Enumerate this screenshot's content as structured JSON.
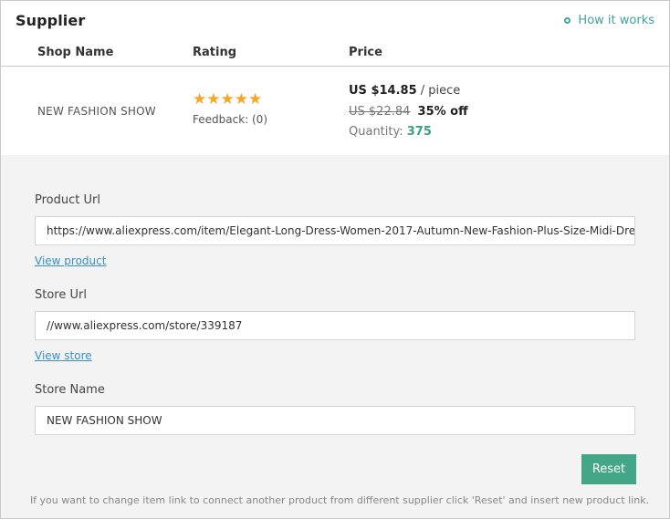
{
  "panel": {
    "title": "Supplier",
    "how_it_works": "How it works"
  },
  "columns": {
    "shop_name": "Shop Name",
    "rating": "Rating",
    "price": "Price"
  },
  "supplier_row": {
    "shop_name": "NEW FASHION SHOW",
    "rating_stars": 5,
    "feedback": "Feedback: (0)",
    "price": "US $14.85",
    "price_unit": "/ piece",
    "old_price": "US $22.84",
    "discount": "35% off",
    "quantity_label": "Quantity:",
    "quantity": "375"
  },
  "form": {
    "product_url_label": "Product Url",
    "product_url_value": "https://www.aliexpress.com/item/Elegant-Long-Dress-Women-2017-Autumn-New-Fashion-Plus-Size-Midi-Dre",
    "view_product": "View product",
    "store_url_label": "Store Url",
    "store_url_value": "//www.aliexpress.com/store/339187",
    "view_store": "View store",
    "store_name_label": "Store Name",
    "store_name_value": "NEW FASHION SHOW",
    "reset_label": "Reset",
    "note": "If you want to change item link to connect another product from different supplier click 'Reset' and insert new product link."
  },
  "colors": {
    "accent": "#43a687",
    "link": "#3a8fc9",
    "star": "#f5a623",
    "teal": "#3fa3a0"
  }
}
